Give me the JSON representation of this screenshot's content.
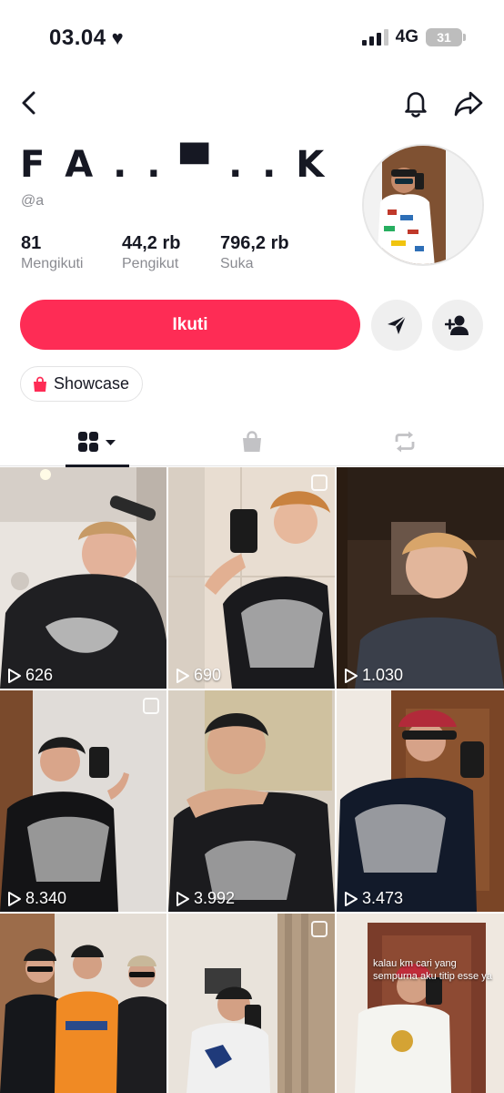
{
  "status_bar": {
    "time": "03.04",
    "network": "4G",
    "battery": "31"
  },
  "profile": {
    "display_name": "F A . . ▀ . . K",
    "handle": "@a",
    "stats": [
      {
        "value": "81",
        "label": "Mengikuti"
      },
      {
        "value": "44,2 rb",
        "label": "Pengikut"
      },
      {
        "value": "796,2 rb",
        "label": "Suka"
      }
    ]
  },
  "actions": {
    "follow_label": "Ikuti",
    "showcase_label": "Showcase"
  },
  "tabs": [
    {
      "icon": "grid-icon",
      "active": true
    },
    {
      "icon": "shopping-bag-icon",
      "active": false
    },
    {
      "icon": "repost-icon",
      "active": false
    }
  ],
  "videos": [
    {
      "views": "626"
    },
    {
      "views": "690"
    },
    {
      "views": "1.030"
    },
    {
      "views": "8.340"
    },
    {
      "views": "3.992"
    },
    {
      "views": "3.473"
    },
    {
      "views": ""
    },
    {
      "views": ""
    },
    {
      "views": "",
      "caption": "kalau km cari yang sempurna aku titip esse ya"
    }
  ],
  "colors": {
    "accent": "#fe2c55",
    "text": "#161823",
    "muted": "#8a8b91"
  }
}
